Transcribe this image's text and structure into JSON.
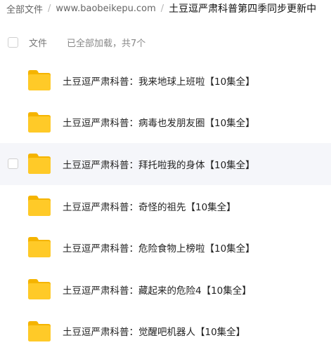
{
  "breadcrumb": {
    "root": "全部文件",
    "level1": "www.baobeikepu.com",
    "current": "土豆逗严肃科普第四季同步更新中",
    "separator": "/"
  },
  "header": {
    "column_file": "文件",
    "status": "已全部加载，共7个"
  },
  "files": [
    {
      "name": "土豆逗严肃科普：我来地球上班啦【10集全】",
      "icon": "folder-icon"
    },
    {
      "name": "土豆逗严肃科普：病毒也发朋友圈【10集全】",
      "icon": "folder-icon"
    },
    {
      "name": "土豆逗严肃科普：拜托啦我的身体【10集全】",
      "icon": "folder-icon"
    },
    {
      "name": "土豆逗严肃科普：奇怪的祖先【10集全】",
      "icon": "folder-icon"
    },
    {
      "name": "土豆逗严肃科普：危险食物上榜啦【10集全】",
      "icon": "folder-icon"
    },
    {
      "name": "土豆逗严肃科普：藏起来的危险4【10集全】",
      "icon": "folder-icon"
    },
    {
      "name": "土豆逗严肃科普：觉醒吧机器人【10集全】",
      "icon": "folder-icon"
    }
  ],
  "colors": {
    "folder_front": "#FFCA28",
    "folder_back": "#F5B400",
    "hover_row": "#f5f6fa"
  }
}
